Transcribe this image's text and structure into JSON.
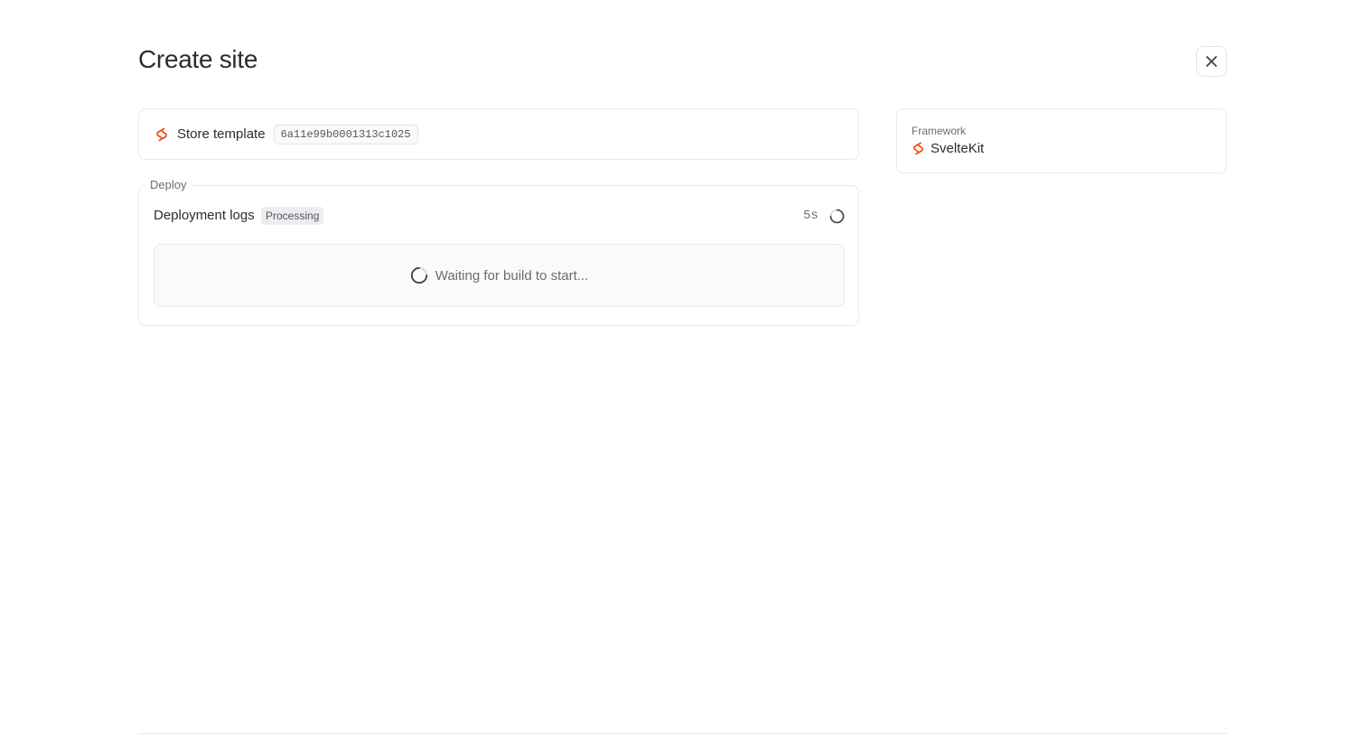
{
  "header": {
    "title": "Create site",
    "close_icon": "close-icon"
  },
  "template": {
    "icon": "svelte-logo",
    "name": "Store template",
    "id": "6a11e99b0001313c1025"
  },
  "deploy": {
    "legend": "Deploy",
    "logs_title": "Deployment logs",
    "status": "Processing",
    "elapsed": "5s",
    "waiting_text": "Waiting for build to start..."
  },
  "framework": {
    "label": "Framework",
    "icon": "svelte-logo",
    "name": "SvelteKit"
  },
  "colors": {
    "brand": "#ff3e00",
    "text": "#2d2d31",
    "muted": "#6c6c71",
    "border": "#e8e8ea"
  }
}
